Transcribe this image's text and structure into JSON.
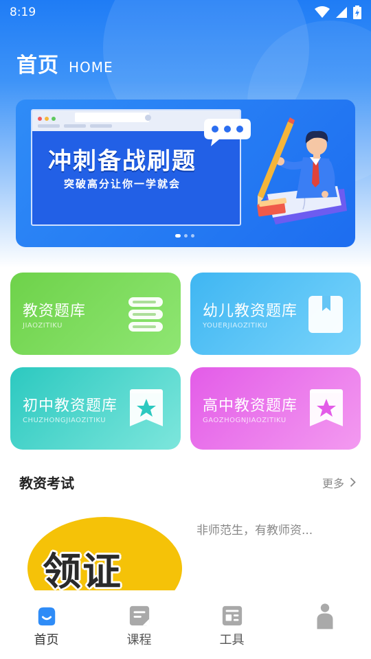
{
  "status_bar": {
    "time": "8:19"
  },
  "header": {
    "title": "首页",
    "subtitle": "HOME"
  },
  "banner": {
    "title": "冲刺备战刷题",
    "subtitle": "突破高分让你一学就会",
    "page_indicator": {
      "count": 3,
      "active": 1
    }
  },
  "categories": [
    {
      "title": "教资题库",
      "subtitle": "JIAOZITIKU",
      "colors": [
        "#6ed24a",
        "#8fe673"
      ],
      "icon": "books-icon"
    },
    {
      "title": "幼儿教资题库",
      "subtitle": "YOUERJIAOZITIKU",
      "colors": [
        "#3fb6f2",
        "#7ad4fb"
      ],
      "icon": "bookmark-book-icon"
    },
    {
      "title": "初中教资题库",
      "subtitle": "CHUZHONGJIAOZITIKU",
      "colors": [
        "#2cc9c0",
        "#7de6dc"
      ],
      "icon": "star-book-icon"
    },
    {
      "title": "高中教资题库",
      "subtitle": "GAOZHOGNJIAOZITIKU",
      "colors": [
        "#e35ce8",
        "#f39af0"
      ],
      "icon": "star-book-icon"
    }
  ],
  "section": {
    "title": "教资考试",
    "more_label": "更多"
  },
  "articles": [
    {
      "thumb_text": "领证",
      "title": "非师范生，有教师资..."
    }
  ],
  "tabbar": {
    "active": 0,
    "items": [
      {
        "label": "首页",
        "icon": "home-icon"
      },
      {
        "label": "课程",
        "icon": "course-icon"
      },
      {
        "label": "工具",
        "icon": "tools-icon"
      },
      {
        "label": "",
        "icon": "profile-icon"
      }
    ]
  },
  "colors": {
    "accent": "#1f7cf5",
    "tab_active": "#2f8cf7",
    "tab_inactive": "#a9a9a9"
  }
}
